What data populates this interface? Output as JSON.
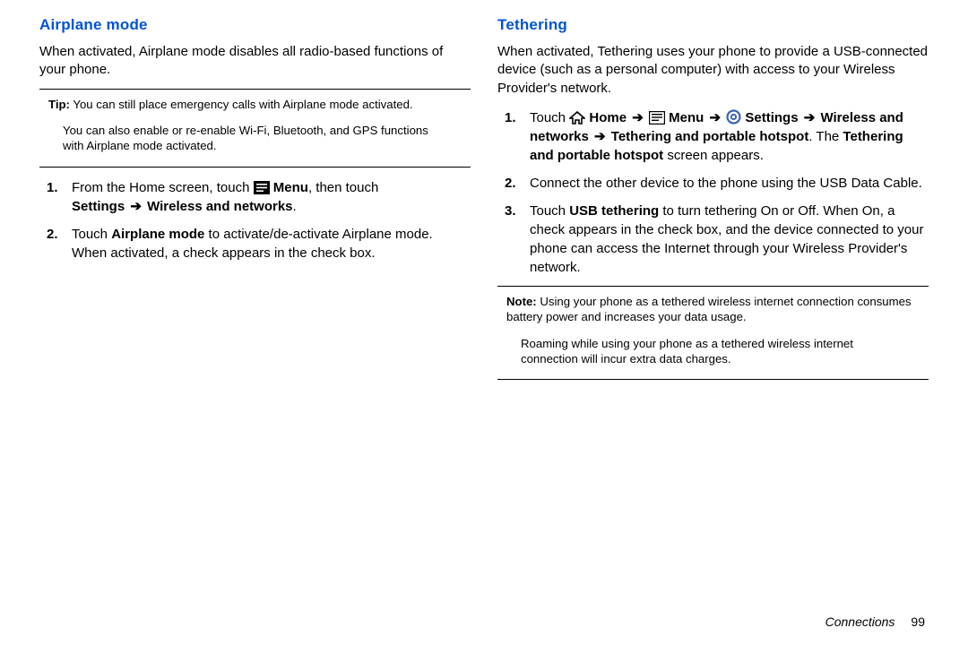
{
  "left": {
    "heading": "Airplane mode",
    "intro": "When activated, Airplane mode disables all radio-based functions of your phone.",
    "tip_label": "Tip:",
    "tip_text": " You can still place emergency calls with Airplane mode activated.",
    "tip_sub": "You can also enable or re-enable Wi-Fi, Bluetooth, and GPS functions with Airplane mode activated.",
    "steps": {
      "n1": "1.",
      "s1a": "From the Home screen, touch ",
      "s1_menu": " Menu",
      "s1b": ", then touch ",
      "s1_settings": "Settings ",
      "s1_arrow": "➔",
      "s1_wireless": " Wireless and networks",
      "s1_period": ".",
      "n2": "2.",
      "s2a": "Touch ",
      "s2_am": "Airplane mode",
      "s2b": " to activate/de-activate Airplane mode. When activated, a check appears in the check box."
    }
  },
  "right": {
    "heading": "Tethering",
    "intro": "When activated, Tethering uses your phone to provide a USB-connected device (such as a personal computer) with access to your Wireless Provider's network.",
    "steps": {
      "n1": "1.",
      "s1_touch": "Touch ",
      "s1_home": " Home ",
      "s1_arrow": "➔",
      "s1_menu": " Menu ",
      "s1_settings_prefix": "  ",
      "s1_settings": "Settings ",
      "s1_wireless": "Wireless and networks ",
      "s1_tph": " Tethering and portable hotspot",
      "s1_period": ". ",
      "s1_tail_a": "The ",
      "s1_tail_b": "Tethering and portable hotspot",
      "s1_tail_c": " screen appears.",
      "n2": "2.",
      "s2": "Connect the other device to the phone using the USB Data Cable.",
      "n3": "3.",
      "s3a": "Touch ",
      "s3_usb": "USB tethering",
      "s3b": " to turn tethering On or Off. When On, a check appears in the check box, and the device connected to your phone can access the Internet through your Wireless Provider's network."
    },
    "note_label": "Note:",
    "note_text": " Using your phone as a tethered wireless internet connection consumes battery power and increases your data usage.",
    "note_sub": "Roaming while using your phone as a tethered wireless internet connection will incur extra data charges."
  },
  "footer": {
    "section": "Connections",
    "page": "99"
  }
}
